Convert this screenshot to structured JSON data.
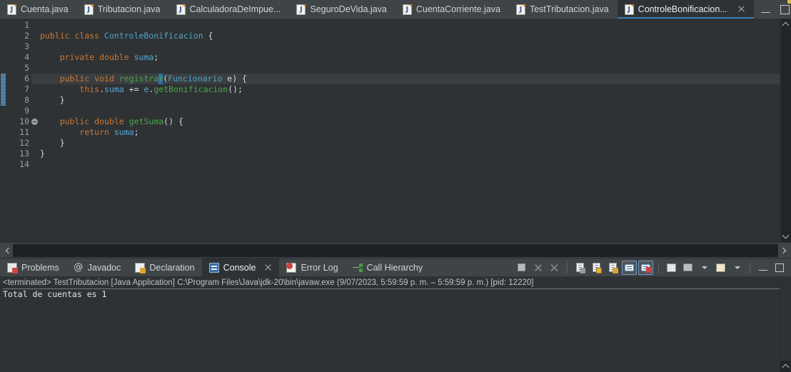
{
  "editor_tabs": [
    {
      "label": "Cuenta.java",
      "icon": "java-file-icon",
      "active": false,
      "closable": false
    },
    {
      "label": "Tributacion.java",
      "icon": "java-file-icon",
      "active": false,
      "closable": false
    },
    {
      "label": "CalculadoraDeImpue...",
      "icon": "java-file-icon",
      "active": false,
      "closable": false
    },
    {
      "label": "SeguroDeVida.java",
      "icon": "java-file-icon",
      "active": false,
      "closable": false
    },
    {
      "label": "CuentaCorriente.java",
      "icon": "java-file-icon",
      "active": false,
      "closable": false
    },
    {
      "label": "TestTributacion.java",
      "icon": "java-file-icon",
      "active": false,
      "closable": false
    },
    {
      "label": "ControleBonificacion...",
      "icon": "java-file-icon",
      "active": true,
      "closable": true
    }
  ],
  "window_controls": {
    "minimize": "minimize-icon",
    "maximize": "maximize-icon"
  },
  "editor": {
    "active_file": "ControleBonificacion...",
    "line_numbers": [
      "1",
      "2",
      "3",
      "4",
      "5",
      "6",
      "7",
      "8",
      "9",
      "10",
      "11",
      "12",
      "13",
      "14"
    ],
    "fold_markers_on_lines": [
      "6",
      "10"
    ],
    "highlighted_line": "6",
    "change_marker_lines": [
      "6",
      "7",
      "8"
    ],
    "lines": [
      "",
      "public class ControleBonificacion {",
      "",
      "    private double suma;",
      "",
      "    public void registrar(Funcionario e) {",
      "        this.suma += e.getBonificacion();",
      "    }",
      "",
      "    public double getSuma() {",
      "        return suma;",
      "    }",
      "}",
      ""
    ],
    "colors": {
      "background": "#2e3234",
      "keyword": "#cc7832",
      "type": "#4fa3c7",
      "method": "#4ea64e",
      "field": "#5ba7d6",
      "text": "#d8d8d8",
      "line_number": "#9aa0a4",
      "current_line": "#3a3e41",
      "change_marker": "#3c79a8"
    },
    "scroll_up": "scroll-up-icon",
    "scroll_down": "scroll-down-icon",
    "scroll_left": "scroll-left-icon",
    "scroll_right": "scroll-right-icon"
  },
  "view_tabs": [
    {
      "label": "Problems",
      "icon": "problems-icon",
      "active": false,
      "closable": false
    },
    {
      "label": "Javadoc",
      "icon": "javadoc-icon",
      "active": false,
      "closable": false
    },
    {
      "label": "Declaration",
      "icon": "declaration-icon",
      "active": false,
      "closable": false
    },
    {
      "label": "Console",
      "icon": "console-icon",
      "active": true,
      "closable": true
    },
    {
      "label": "Error Log",
      "icon": "error-log-icon",
      "active": false,
      "closable": false
    },
    {
      "label": "Call Hierarchy",
      "icon": "call-hierarchy-icon",
      "active": false,
      "closable": false
    }
  ],
  "console_toolbar": [
    {
      "name": "terminate-button",
      "enabled": true,
      "toggled": false
    },
    {
      "name": "remove-launch-button",
      "enabled": false,
      "toggled": false
    },
    {
      "name": "remove-all-launches-button",
      "enabled": false,
      "toggled": false
    },
    {
      "name": "clear-console-button",
      "enabled": true,
      "toggled": false
    },
    {
      "name": "scroll-lock-button",
      "enabled": true,
      "toggled": false
    },
    {
      "name": "word-wrap-button",
      "enabled": true,
      "toggled": false
    },
    {
      "name": "show-console-on-output-button",
      "enabled": true,
      "toggled": true
    },
    {
      "name": "show-console-on-error-button",
      "enabled": true,
      "toggled": true
    },
    {
      "name": "pin-console-button",
      "enabled": true,
      "toggled": false
    },
    {
      "name": "display-selected-console-button",
      "enabled": true,
      "toggled": false
    },
    {
      "name": "display-console-dropdown",
      "enabled": true,
      "toggled": false
    },
    {
      "name": "open-console-button",
      "enabled": true,
      "toggled": false
    },
    {
      "name": "open-console-dropdown",
      "enabled": true,
      "toggled": false
    },
    {
      "name": "minimize-view-button",
      "enabled": true,
      "toggled": false
    },
    {
      "name": "maximize-view-button",
      "enabled": true,
      "toggled": false
    }
  ],
  "console": {
    "launch_line": "<terminated> TestTributacion [Java Application] C:\\Program Files\\Java\\jdk-20\\bin\\javaw.exe  (9/07/2023, 5:59:59 p. m. – 5:59:59 p. m.) [pid: 12220]",
    "output_lines": [
      "Total de cuentas es 1"
    ],
    "scroll_down": "console-scroll-down-icon"
  }
}
